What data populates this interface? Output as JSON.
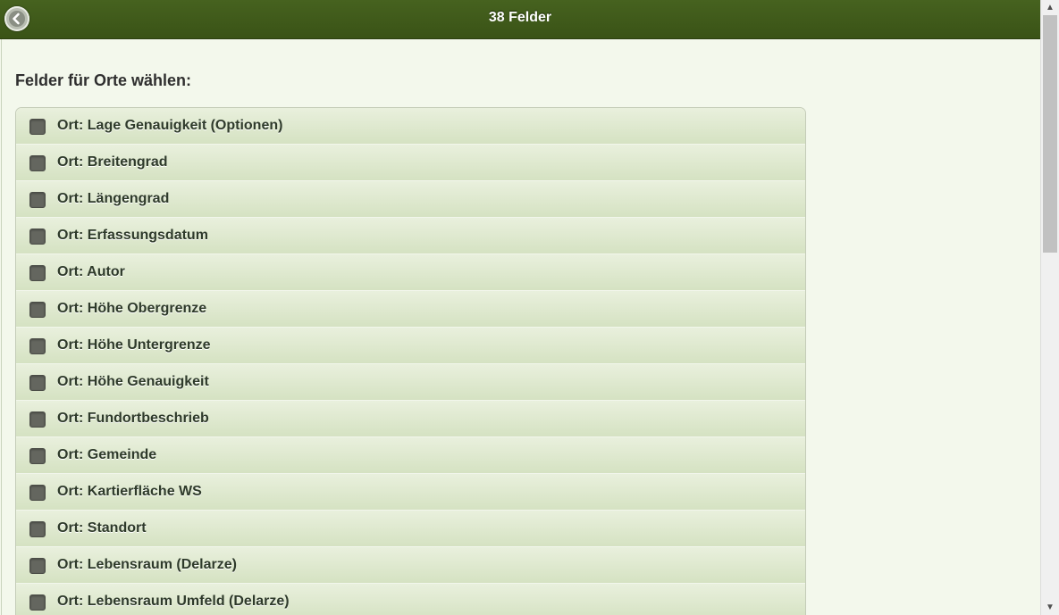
{
  "header": {
    "title": "38 Felder",
    "back_icon": "back-circle-arrow-icon"
  },
  "section": {
    "heading": "Felder für Orte wählen:"
  },
  "fields": [
    {
      "label": "Ort: Lage Genauigkeit (Optionen)",
      "checked": false
    },
    {
      "label": "Ort: Breitengrad",
      "checked": false
    },
    {
      "label": "Ort: Längengrad",
      "checked": false
    },
    {
      "label": "Ort: Erfassungsdatum",
      "checked": false
    },
    {
      "label": "Ort: Autor",
      "checked": false
    },
    {
      "label": "Ort: Höhe Obergrenze",
      "checked": false
    },
    {
      "label": "Ort: Höhe Untergrenze",
      "checked": false
    },
    {
      "label": "Ort: Höhe Genauigkeit",
      "checked": false
    },
    {
      "label": "Ort: Fundortbeschrieb",
      "checked": false
    },
    {
      "label": "Ort: Gemeinde",
      "checked": false
    },
    {
      "label": "Ort: Kartierfläche WS",
      "checked": false
    },
    {
      "label": "Ort: Standort",
      "checked": false
    },
    {
      "label": "Ort: Lebensraum (Delarze)",
      "checked": false
    },
    {
      "label": "Ort: Lebensraum Umfeld (Delarze)",
      "checked": false
    }
  ],
  "colors": {
    "header_bg": "#3f5a1a",
    "page_bg": "#f3f8ec",
    "list_item_bg": "#dde8cc",
    "checkbox": "#64665f"
  }
}
